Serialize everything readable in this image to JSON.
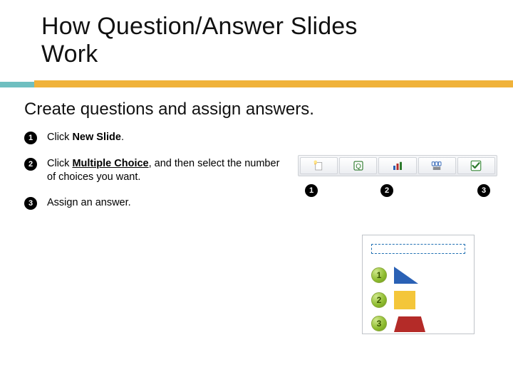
{
  "title_line1": "How Question/Answer Slides",
  "title_line2": "Work",
  "subtitle": "Create questions and assign answers.",
  "steps": [
    {
      "num": "1",
      "html_parts": [
        "Click ",
        {
          "b": "New Slide"
        },
        "."
      ]
    },
    {
      "num": "2",
      "html_parts": [
        "Click ",
        {
          "bu": "Multiple Choice"
        },
        ", and then select the number of choices you want."
      ]
    },
    {
      "num": "3",
      "html_parts": [
        "Assign an answer."
      ]
    }
  ],
  "toolbar_icons": [
    "new-slide-icon",
    "question-icon",
    "bar-chart-icon",
    "responses-icon",
    "check-icon"
  ],
  "markers": [
    "1",
    "2",
    "3"
  ],
  "choices": [
    {
      "n": "1",
      "shape": "triangle",
      "color": "#2a61b5"
    },
    {
      "n": "2",
      "shape": "square",
      "color": "#f4c63a"
    },
    {
      "n": "3",
      "shape": "trapezoid",
      "color": "#b42b28"
    }
  ]
}
